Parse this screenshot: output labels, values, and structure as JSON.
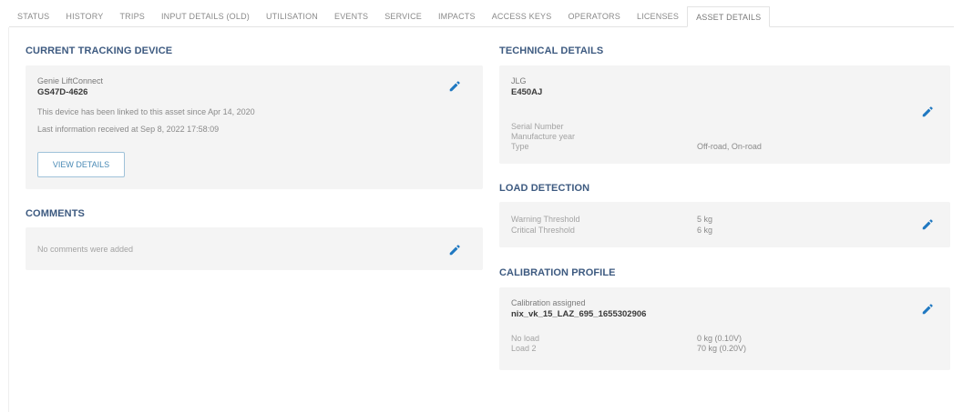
{
  "tabs": [
    {
      "label": "STATUS"
    },
    {
      "label": "HISTORY"
    },
    {
      "label": "TRIPS"
    },
    {
      "label": "INPUT DETAILS (OLD)"
    },
    {
      "label": "UTILISATION"
    },
    {
      "label": "EVENTS"
    },
    {
      "label": "SERVICE"
    },
    {
      "label": "IMPACTS"
    },
    {
      "label": "ACCESS KEYS"
    },
    {
      "label": "OPERATORS"
    },
    {
      "label": "LICENSES"
    },
    {
      "label": "ASSET DETAILS"
    }
  ],
  "active_tab": "ASSET DETAILS",
  "tracking": {
    "title": "CURRENT TRACKING DEVICE",
    "device_name": "Genie LiftConnect",
    "device_id": "GS47D-4626",
    "linked_text": "This device has been linked to this asset since Apr 14, 2020",
    "last_info_text": "Last information received at Sep 8, 2022 17:58:09",
    "view_details_label": "VIEW DETAILS"
  },
  "comments": {
    "title": "COMMENTS",
    "empty_text": "No comments were added"
  },
  "technical": {
    "title": "TECHNICAL DETAILS",
    "brand": "JLG",
    "model": "E450AJ",
    "serial_label": "Serial Number",
    "manufacture_label": "Manufacture year",
    "type_label": "Type",
    "type_value": "Off-road, On-road"
  },
  "load_detection": {
    "title": "LOAD DETECTION",
    "warning_label": "Warning Threshold",
    "warning_value": "5 kg",
    "critical_label": "Critical Threshold",
    "critical_value": "6 kg"
  },
  "calibration": {
    "title": "CALIBRATION PROFILE",
    "assigned_label": "Calibration assigned",
    "profile_name": "nix_vk_15_LAZ_695_1655302906",
    "no_load_label": "No load",
    "no_load_value": "0 kg (0.10V)",
    "load2_label": "Load 2",
    "load2_value": "70 kg (0.20V)"
  },
  "colors": {
    "accent": "#1f78c1",
    "section_title": "#3d5a80",
    "card_bg": "#f4f4f4"
  },
  "icons": {
    "edit": "pencil-icon"
  }
}
